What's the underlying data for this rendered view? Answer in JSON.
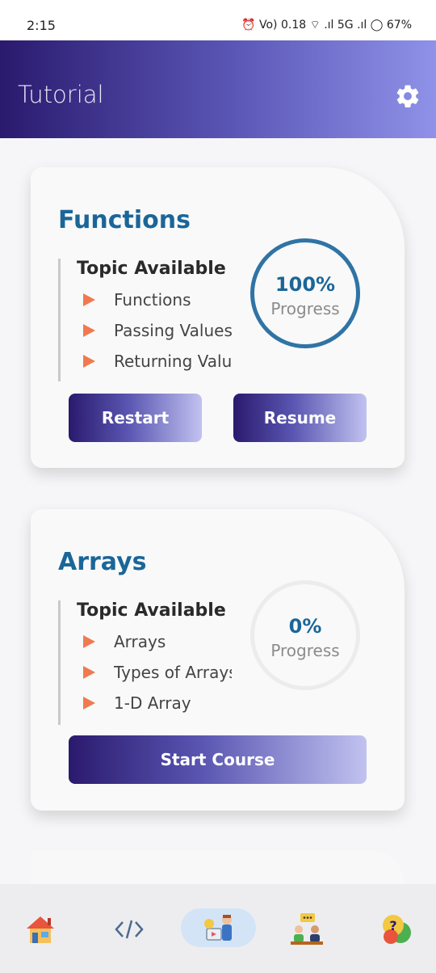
{
  "status": {
    "time": "2:15",
    "right": "⏰ Vo) 0.18 ⌔ .ıl 5G .ıl ◯ 67%"
  },
  "app_bar": {
    "title": "Tutorial",
    "settings_icon": "gear-icon"
  },
  "courses": [
    {
      "title": "Functions",
      "topics_heading": "Topic Available",
      "topics": [
        "Functions",
        "Passing Values",
        "Returning Value"
      ],
      "progress_value": "100%",
      "progress_fraction": 1.0,
      "progress_label": "Progress",
      "buttons": [
        "Restart",
        "Resume"
      ]
    },
    {
      "title": "Arrays",
      "topics_heading": "Topic Available",
      "topics": [
        "Arrays",
        "Types of Arrays",
        "1-D Array"
      ],
      "progress_value": "0%",
      "progress_fraction": 0.0,
      "progress_label": "Progress",
      "button": "Start Course"
    }
  ],
  "bottom_nav": [
    {
      "name": "home-icon"
    },
    {
      "name": "code-icon"
    },
    {
      "name": "learning-icon",
      "active": true
    },
    {
      "name": "discussion-icon"
    },
    {
      "name": "help-icon"
    }
  ],
  "colors": {
    "accent": "#1a6699",
    "header_start": "#2a1a6e",
    "header_end": "#8f92e8",
    "bullet": "#f07a50"
  }
}
